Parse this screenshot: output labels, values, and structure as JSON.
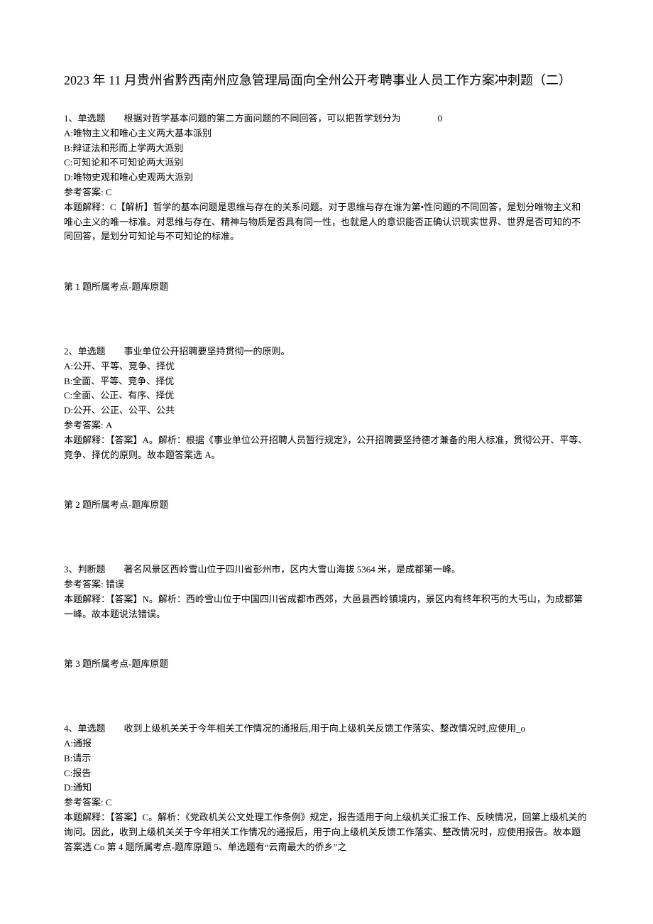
{
  "title": "2023 年 11 月贵州省黔西南州应急管理局面向全州公开考聘事业人员工作方案冲刺题（二）",
  "q1": {
    "stem": "1、单选题　　根据对哲学基本问题的第二方面问题的不同回答，可以把哲学划分为　　　　0",
    "optA": "A:唯物主义和唯心主义两大基本派别",
    "optB": "B:辩证法和形而上学两大派别",
    "optC": "C:可知论和不可知论两大派别",
    "optD": "D:唯物史观和唯心史观两大派别",
    "ansLabel": "参考答案: C",
    "explain": "本题解释：C【解析】哲学的基本问题是思维与存在的关系问题。对于思维与存在谁为第•性问题的不同回答，是划分唯物主义和唯心主义的唯一标准。对思维与存在、精神与物质是否具有同一性，也就是人的意识能否正确认识现实世界、世界是否可知的不同回答，是划分可知论与不可知论的标准。",
    "topic": "第 1 题所属考点-题库原题"
  },
  "q2": {
    "stem": "2、单选题　　事业单位公开招聘要坚持贯彻一的原则。",
    "optA": "A:公开、平等、竞争、择优",
    "optB": "B:全面、平等、竞争、择优",
    "optC": "C:全面、公正、有序、择优",
    "optD": "D:公开、公正、公平、公共",
    "ansLabel": "参考答案: A",
    "explain": "本题解释：【答案】A。解析：根据《事业单位公开招聘人员暂行规定》，公开招聘要坚持德才兼备的用人标准，贯彻公开、平等、竞争、择优的原则。故本题答案选 A。",
    "topic": "第 2 题所属考点-题库原题"
  },
  "q3": {
    "stem": "3、判断题　　著名风景区西岭雪山位于四川省彭州市，区内大雪山海拔 5364 米，是成都第一峰。",
    "ansLabel": "参考答案: 错误",
    "explain": "本题解释：【答案】N。解析：西岭雪山位于中国四川省成都市西郊，大邑县西岭镇境内，景区内有终年积丐的大丐山，为成都第一峰。故本题说法错误。",
    "topic": "第 3 题所属考点-题库原题"
  },
  "q4": {
    "stem": "4、单选题　　收到上级机关关于今年相关工作情况的通报后,用于向上级机关反馈工作落实、整改情况时,应使用_o",
    "optA": "A:通报",
    "optB": "B:请示",
    "optC": "C:报告",
    "optD": "D:通知",
    "ansLabel": "参考答案: C",
    "explain": "本题解释：【答案】C。解析：《党政机关公文处理工作条例》规定，报告适用于向上级机关汇报工作、反映情况，回第上级机关的询问。因此，收到上级机关关于今年相关工作情况的通报后，用于向上级机关反馈工作落实、整改情况时，应使用报告。故本题答案选 Co 第 4 题所属考点-题库原题 5、单选题有“云南最大的侨乡”之"
  }
}
